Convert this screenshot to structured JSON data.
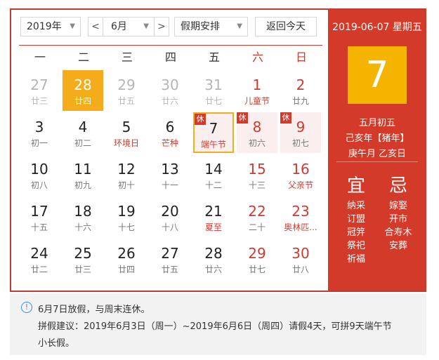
{
  "toolbar": {
    "year": "2019年",
    "month": "6月",
    "prev": "<",
    "next": ">",
    "holiday": "假期安排",
    "today": "返回今天"
  },
  "weekdays": [
    "一",
    "二",
    "三",
    "四",
    "五",
    "六",
    "日"
  ],
  "weeks": [
    [
      {
        "d": "27",
        "l": "廿三",
        "type": "other"
      },
      {
        "d": "28",
        "l": "廿四",
        "type": "selected"
      },
      {
        "d": "29",
        "l": "廿五",
        "type": "other"
      },
      {
        "d": "30",
        "l": "廿六",
        "type": "other"
      },
      {
        "d": "31",
        "l": "廿七",
        "type": "other"
      },
      {
        "d": "1",
        "l": "儿童节",
        "type": "weekend",
        "fest": true
      },
      {
        "d": "2",
        "l": "廿九",
        "type": "weekend"
      }
    ],
    [
      {
        "d": "3",
        "l": "初一"
      },
      {
        "d": "4",
        "l": "初二"
      },
      {
        "d": "5",
        "l": "环境日",
        "fest": true
      },
      {
        "d": "6",
        "l": "芒种",
        "fest": true
      },
      {
        "d": "7",
        "l": "端午节",
        "fest": true,
        "rest": true,
        "current": true,
        "badge": "休"
      },
      {
        "d": "8",
        "l": "初六",
        "type": "weekend",
        "rest": true,
        "badge": "休"
      },
      {
        "d": "9",
        "l": "初七",
        "type": "weekend",
        "rest": true,
        "badge": "休"
      }
    ],
    [
      {
        "d": "10",
        "l": "初八"
      },
      {
        "d": "11",
        "l": "初九"
      },
      {
        "d": "12",
        "l": "初十"
      },
      {
        "d": "13",
        "l": "十一"
      },
      {
        "d": "14",
        "l": "十二"
      },
      {
        "d": "15",
        "l": "十三",
        "type": "weekend"
      },
      {
        "d": "16",
        "l": "父亲节",
        "type": "weekend",
        "fest": true
      }
    ],
    [
      {
        "d": "17",
        "l": "十五"
      },
      {
        "d": "18",
        "l": "十六"
      },
      {
        "d": "19",
        "l": "十七"
      },
      {
        "d": "20",
        "l": "十八"
      },
      {
        "d": "21",
        "l": "夏至",
        "fest": true
      },
      {
        "d": "22",
        "l": "二十",
        "type": "weekend"
      },
      {
        "d": "23",
        "l": "奥林匹...",
        "type": "weekend",
        "fest": true
      }
    ],
    [
      {
        "d": "24",
        "l": "廿二"
      },
      {
        "d": "25",
        "l": "廿三"
      },
      {
        "d": "26",
        "l": "廿四"
      },
      {
        "d": "27",
        "l": "廿五"
      },
      {
        "d": "28",
        "l": "廿六"
      },
      {
        "d": "29",
        "l": "廿七",
        "type": "weekend"
      },
      {
        "d": "30",
        "l": "廿八",
        "type": "weekend"
      }
    ]
  ],
  "detail": {
    "date": "2019-06-07 星期五",
    "day": "7",
    "lunar": "五月初五",
    "ganzhi_year": "己亥年【猪年】",
    "ganzhi_month_day": "庚午月 乙亥日",
    "yi_title": "宜",
    "ji_title": "忌",
    "yi": [
      "纳采",
      "订盟",
      "冠笄",
      "祭祀",
      "祈福"
    ],
    "ji": [
      "嫁娶",
      "开市",
      "合寿木",
      "安葬"
    ]
  },
  "notice": {
    "line1": "6月7日放假，与周末连休。",
    "line2": "拼假建议：2019年6月3日（周一）~2019年6月6日（周四）请假4天，可拼9天端午节",
    "line3": "小长假。"
  },
  "colors": {
    "accent": "#d33a2a",
    "selected": "#f4ac1a",
    "rest_bg": "#fbeeee"
  }
}
